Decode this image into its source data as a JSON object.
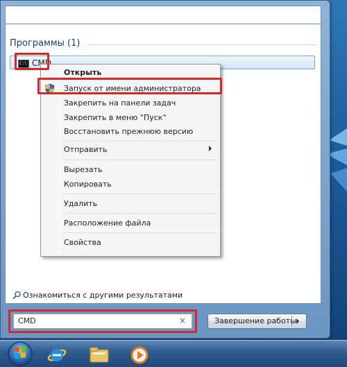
{
  "start_menu": {
    "group_header": "Программы (1)",
    "result_item": {
      "label": "CMD",
      "icon": "cmd-icon"
    },
    "context_menu": {
      "items": [
        {
          "label": "Открыть",
          "bold": true
        },
        {
          "label": "Запуск от имени администратора",
          "icon": "shield-icon"
        },
        {
          "label": "Закрепить на панели задач"
        },
        {
          "label": "Закрепить в меню \"Пуск\""
        },
        {
          "label": "Восстановить прежнюю версию"
        },
        {
          "label": "Отправить",
          "submenu": true
        },
        {
          "label": "Вырезать"
        },
        {
          "label": "Копировать"
        },
        {
          "label": "Удалить"
        },
        {
          "label": "Расположение файла"
        },
        {
          "label": "Свойства"
        }
      ]
    },
    "more_results": "Ознакомиться с другими результатами",
    "search": {
      "value": "CMD",
      "clear_glyph": "×"
    },
    "shutdown": {
      "label": "Завершение работы"
    }
  },
  "taskbar": {
    "items": [
      "start-orb",
      "internet-explorer-icon",
      "windows-explorer-icon",
      "media-player-icon"
    ]
  },
  "colors": {
    "highlight_frame": "#d62828",
    "menu_header_text": "#1c3d74",
    "taskbar": "#2c5a8d"
  }
}
